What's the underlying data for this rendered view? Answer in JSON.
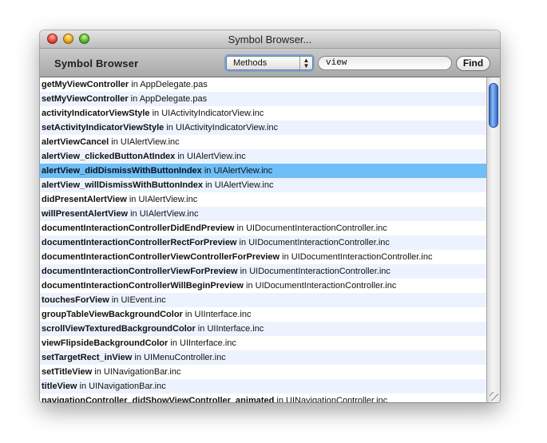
{
  "window": {
    "title": "Symbol Browser..."
  },
  "toolbar": {
    "title": "Symbol Browser",
    "popup_selected": "Methods",
    "search_value": "view",
    "find_label": "Find"
  },
  "list": {
    "selected_index": 6,
    "rows": [
      {
        "symbol": "getMyViewController",
        "sep": " in ",
        "file": "AppDelegate.pas"
      },
      {
        "symbol": "setMyViewController",
        "sep": " in ",
        "file": "AppDelegate.pas"
      },
      {
        "symbol": "activityIndicatorViewStyle",
        "sep": " in ",
        "file": "UIActivityIndicatorView.inc"
      },
      {
        "symbol": "setActivityIndicatorViewStyle",
        "sep": " in ",
        "file": "UIActivityIndicatorView.inc"
      },
      {
        "symbol": "alertViewCancel",
        "sep": " in ",
        "file": "UIAlertView.inc"
      },
      {
        "symbol": "alertView_clickedButtonAtIndex",
        "sep": " in ",
        "file": "UIAlertView.inc"
      },
      {
        "symbol": "alertView_didDismissWithButtonIndex",
        "sep": " in ",
        "file": "UIAlertView.inc"
      },
      {
        "symbol": "alertView_willDismissWithButtonIndex",
        "sep": " in ",
        "file": "UIAlertView.inc"
      },
      {
        "symbol": "didPresentAlertView",
        "sep": " in ",
        "file": "UIAlertView.inc"
      },
      {
        "symbol": "willPresentAlertView",
        "sep": " in ",
        "file": "UIAlertView.inc"
      },
      {
        "symbol": "documentInteractionControllerDidEndPreview",
        "sep": " in ",
        "file": "UIDocumentInteractionController.inc"
      },
      {
        "symbol": "documentInteractionControllerRectForPreview",
        "sep": " in ",
        "file": "UIDocumentInteractionController.inc"
      },
      {
        "symbol": "documentInteractionControllerViewControllerForPreview",
        "sep": " in ",
        "file": "UIDocumentInteractionController.inc"
      },
      {
        "symbol": "documentInteractionControllerViewForPreview",
        "sep": " in ",
        "file": "UIDocumentInteractionController.inc"
      },
      {
        "symbol": "documentInteractionControllerWillBeginPreview",
        "sep": " in ",
        "file": "UIDocumentInteractionController.inc"
      },
      {
        "symbol": "touchesForView",
        "sep": " in ",
        "file": "UIEvent.inc"
      },
      {
        "symbol": "groupTableViewBackgroundColor",
        "sep": " in ",
        "file": "UIInterface.inc"
      },
      {
        "symbol": "scrollViewTexturedBackgroundColor",
        "sep": " in ",
        "file": "UIInterface.inc"
      },
      {
        "symbol": "viewFlipsideBackgroundColor",
        "sep": " in ",
        "file": "UIInterface.inc"
      },
      {
        "symbol": "setTargetRect_inView",
        "sep": " in ",
        "file": "UIMenuController.inc"
      },
      {
        "symbol": "setTitleView",
        "sep": " in ",
        "file": "UINavigationBar.inc"
      },
      {
        "symbol": "titleView",
        "sep": " in ",
        "file": "UINavigationBar.inc"
      },
      {
        "symbol": "navigationController_didShowViewController_animated",
        "sep": " in ",
        "file": "UINavigationController.inc"
      }
    ]
  },
  "colors": {
    "selection": "#6ebef8",
    "alternate_row": "#edf3fe",
    "scroll_thumb": "#5a93e6"
  }
}
